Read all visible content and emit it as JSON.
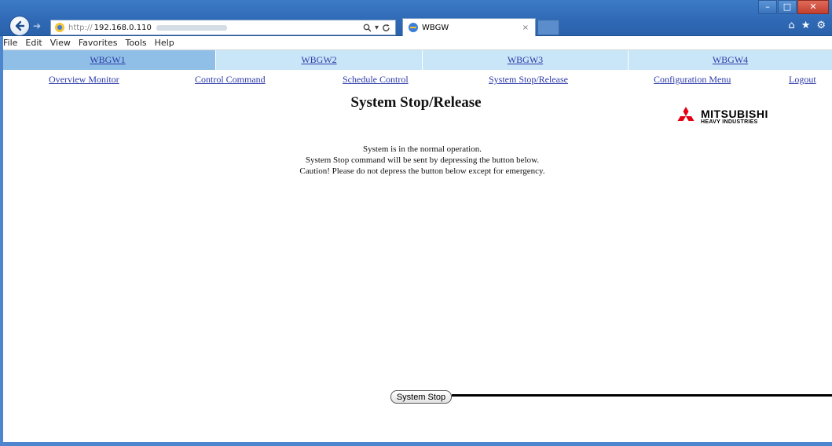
{
  "browser": {
    "address": {
      "scheme": "http://",
      "host": "192.168.0.110"
    },
    "tab": {
      "label": "WBGW",
      "close": "×"
    },
    "menu": [
      "File",
      "Edit",
      "View",
      "Favorites",
      "Tools",
      "Help"
    ],
    "window_controls": {
      "minimize": "–",
      "maximize": "□",
      "close": "✕"
    },
    "toolbar_icons": [
      "home-icon",
      "star-icon",
      "gear-icon"
    ]
  },
  "gateways": [
    {
      "label": "WBGW1",
      "active": true
    },
    {
      "label": "WBGW2",
      "active": false
    },
    {
      "label": "WBGW3",
      "active": false
    },
    {
      "label": "WBGW4",
      "active": false
    }
  ],
  "nav": {
    "overview": "Overview Monitor",
    "control": "Control Command",
    "schedule": "Schedule Control",
    "system": "System Stop/Release",
    "config": "Configuration Menu",
    "logout": "Logout"
  },
  "page": {
    "title": "System Stop/Release",
    "messages": [
      "System is in the normal operation.",
      "System Stop command will be sent by depressing the button below.",
      "Caution! Please do not depress the button below except for emergency."
    ],
    "button": "System Stop"
  },
  "logo": {
    "main": "MITSUBISHI",
    "sub": "HEAVY INDUSTRIES",
    "color": "#e60012"
  },
  "colors": {
    "link": "#2d3aa8",
    "tab_active": "#8fbfe6",
    "tab": "#c8e6f7",
    "chrome": "#2f69b5"
  }
}
